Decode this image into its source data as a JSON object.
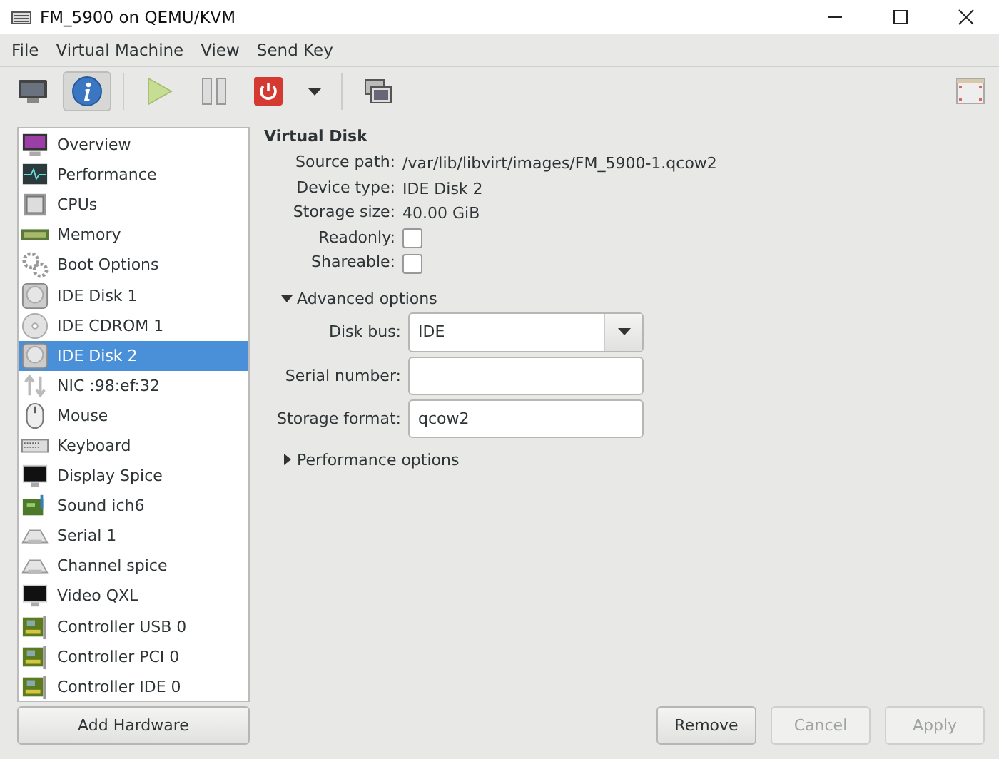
{
  "window": {
    "title": "FM_5900 on QEMU/KVM",
    "controls": [
      {
        "kind": "minimize"
      },
      {
        "kind": "maximize"
      },
      {
        "kind": "close"
      }
    ]
  },
  "menu": [
    "File",
    "Virtual Machine",
    "View",
    "Send Key"
  ],
  "toolbar": [
    {
      "kind": "console",
      "selected": false
    },
    {
      "kind": "details",
      "selected": true
    },
    {
      "kind": "separator"
    },
    {
      "kind": "run",
      "selected": false
    },
    {
      "kind": "pause",
      "selected": false
    },
    {
      "kind": "shutdown",
      "selected": false
    },
    {
      "kind": "caret",
      "selected": false
    },
    {
      "kind": "separator"
    },
    {
      "kind": "snapshots",
      "selected": false
    }
  ],
  "sidebar": {
    "items": [
      {
        "label": "Overview",
        "kind": "monitor",
        "selected": false
      },
      {
        "label": "Performance",
        "kind": "chart",
        "selected": false
      },
      {
        "label": "CPUs",
        "kind": "chip",
        "selected": false
      },
      {
        "label": "Memory",
        "kind": "memory",
        "selected": false
      },
      {
        "label": "Boot Options",
        "kind": "gears",
        "selected": false
      },
      {
        "label": "IDE Disk 1",
        "kind": "disk",
        "selected": false
      },
      {
        "label": "IDE CDROM 1",
        "kind": "cdrom",
        "selected": false
      },
      {
        "label": "IDE Disk 2",
        "kind": "disk",
        "selected": true
      },
      {
        "label": "NIC :98:ef:32",
        "kind": "network",
        "selected": false
      },
      {
        "label": "Mouse",
        "kind": "mouse",
        "selected": false
      },
      {
        "label": "Keyboard",
        "kind": "keyboard",
        "selected": false
      },
      {
        "label": "Display Spice",
        "kind": "display",
        "selected": false
      },
      {
        "label": "Sound ich6",
        "kind": "sound",
        "selected": false
      },
      {
        "label": "Serial 1",
        "kind": "serial",
        "selected": false
      },
      {
        "label": "Channel spice",
        "kind": "serial",
        "selected": false
      },
      {
        "label": "Video QXL",
        "kind": "display",
        "selected": false
      },
      {
        "label": "Controller USB 0",
        "kind": "card",
        "selected": false
      },
      {
        "label": "Controller PCI 0",
        "kind": "card",
        "selected": false
      },
      {
        "label": "Controller IDE 0",
        "kind": "card",
        "selected": false
      }
    ],
    "add_button": "Add Hardware"
  },
  "detail": {
    "heading": "Virtual Disk",
    "fields": [
      {
        "kind": "text",
        "label": "Source path:",
        "value": "/var/lib/libvirt/images/FM_5900-1.qcow2"
      },
      {
        "kind": "text",
        "label": "Device type:",
        "value": "IDE Disk 2"
      },
      {
        "kind": "text",
        "label": "Storage size:",
        "value": "40.00 GiB"
      },
      {
        "kind": "checkbox",
        "label": "Readonly:",
        "checked": false
      },
      {
        "kind": "checkbox",
        "label": "Shareable:",
        "checked": false
      }
    ],
    "advanced": {
      "label": "Advanced options",
      "expanded": true,
      "fields": [
        {
          "kind": "select",
          "label": "Disk bus:",
          "value": "IDE"
        },
        {
          "kind": "entry",
          "label": "Serial number:"
        },
        {
          "kind": "entry",
          "label": "Storage format:",
          "value": "qcow2"
        }
      ]
    },
    "performance": {
      "label": "Performance options",
      "expanded": false
    }
  },
  "buttons": [
    {
      "label": "Remove",
      "disabled": false
    },
    {
      "label": "Cancel",
      "disabled": true
    },
    {
      "label": "Apply",
      "disabled": true
    }
  ]
}
